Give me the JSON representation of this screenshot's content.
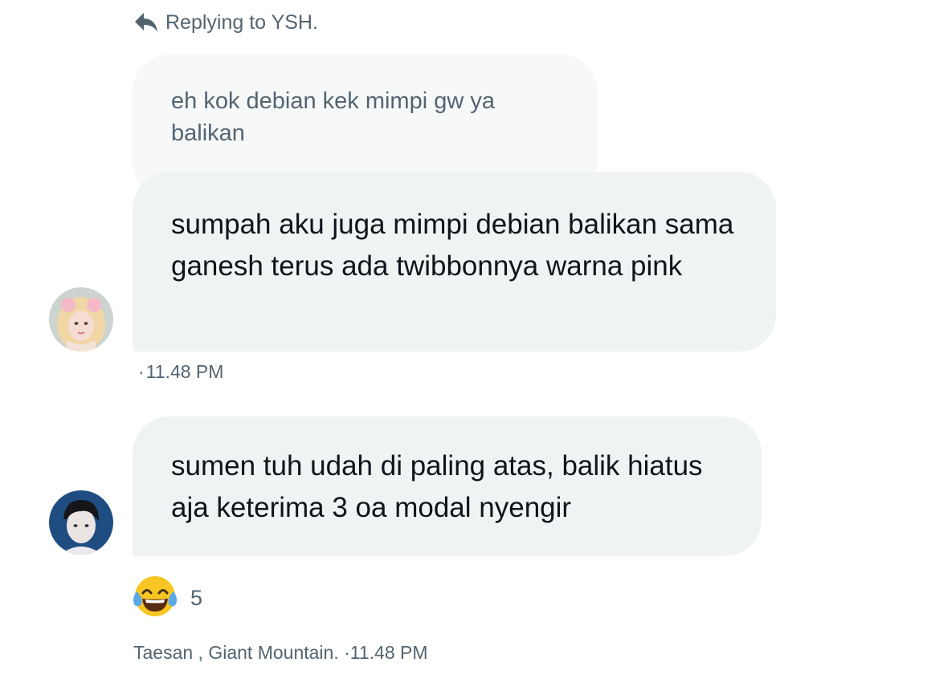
{
  "reply_header": {
    "icon": "reply-arrow-icon",
    "text": "Replying to YSH."
  },
  "quoted_message": {
    "text": "eh kok debian kek mimpi gw ya balikan"
  },
  "messages": [
    {
      "text": "sumpah aku juga mimpi debian balikan sama ganesh terus ada twibbonnya warna pink",
      "timestamp_dot": "·",
      "timestamp": "11.48 PM"
    },
    {
      "text": "sumen tuh udah di paling atas, balik hiatus aja keterima 3 oa modal nyengir",
      "reaction": {
        "emoji": "face-with-tears-of-joy-icon",
        "count": "5"
      }
    }
  ],
  "footer": {
    "seen_by": "Taesan , Giant Mountain.",
    "dot": "·",
    "timestamp": "11.48 PM"
  },
  "colors": {
    "bubble": "#eff3f4",
    "quoted_bubble": "#f7f9f9",
    "secondary_text": "#536471",
    "primary_text": "#0f1419"
  }
}
